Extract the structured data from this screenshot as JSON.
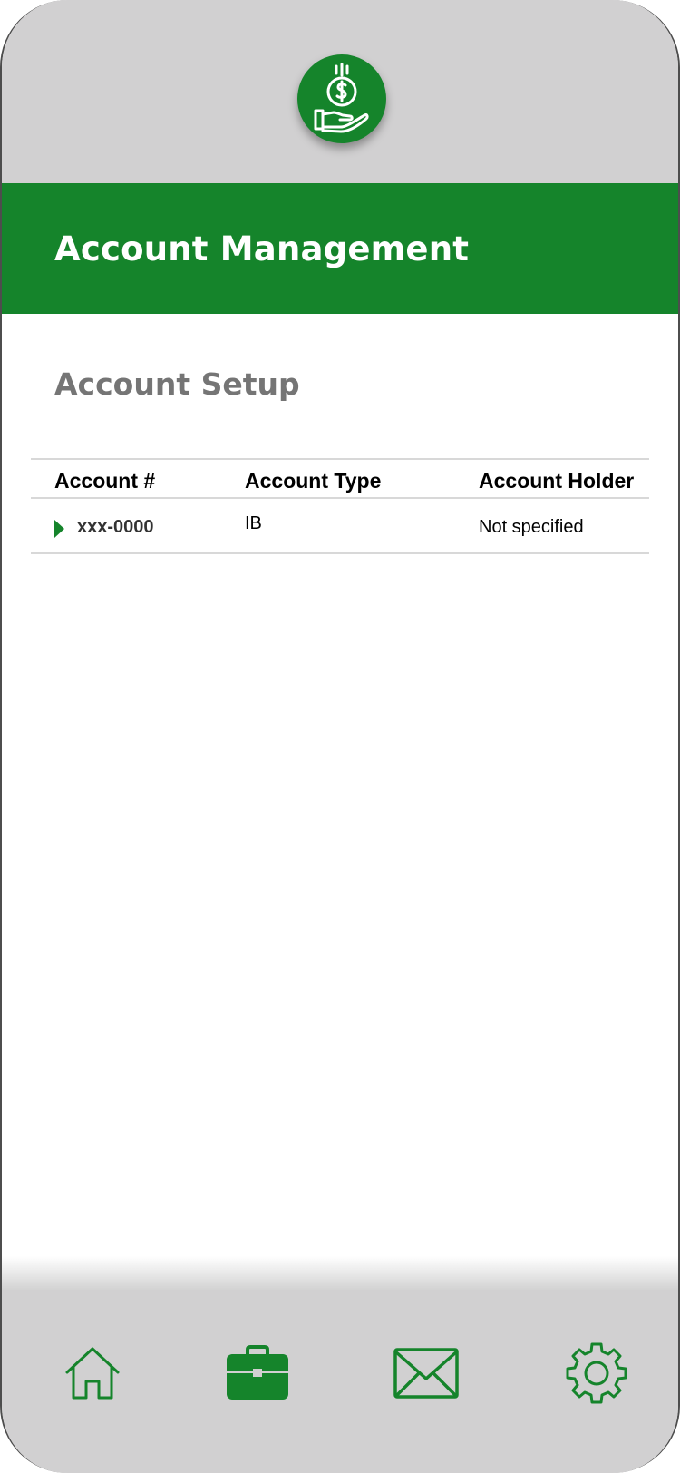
{
  "header": {
    "title": "Account Management"
  },
  "section": {
    "title": "Account Setup"
  },
  "table": {
    "columns": [
      "Account #",
      "Account Type",
      "Account Holder"
    ],
    "rows": [
      {
        "account_number": "xxx-0000",
        "account_type": "IB",
        "account_holder": "Not specified"
      }
    ]
  },
  "colors": {
    "brand_green": "#15842b",
    "chrome_gray": "#d1d0d1"
  },
  "icons": {
    "logo": "hand-holding-dollar-icon",
    "tabs": [
      "home-icon",
      "briefcase-icon",
      "mail-icon",
      "gear-icon"
    ]
  }
}
